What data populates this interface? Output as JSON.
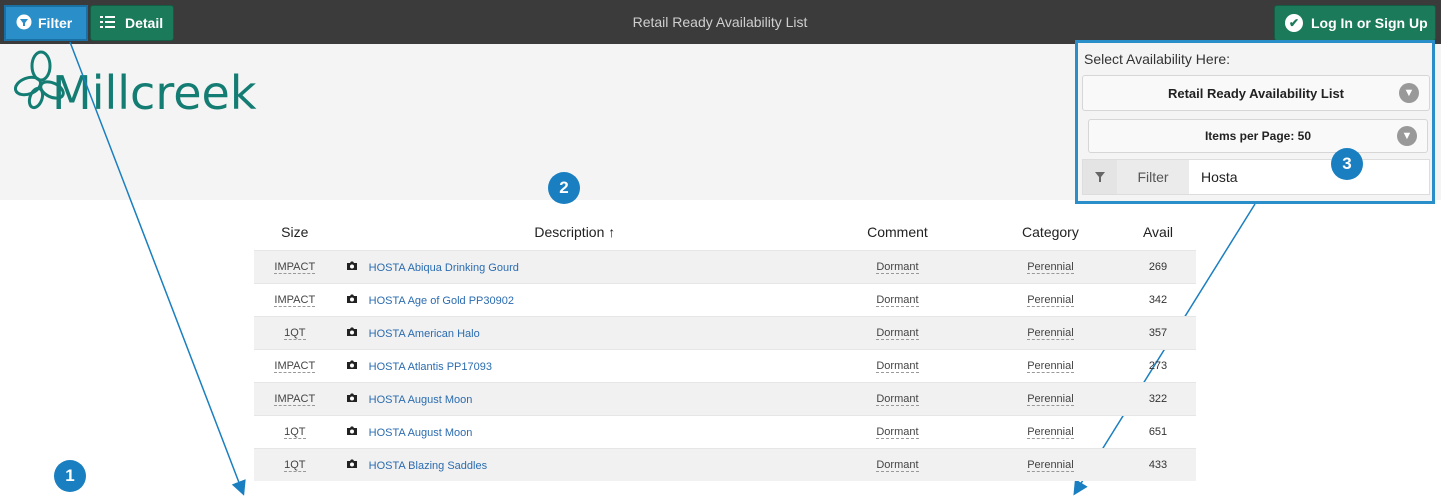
{
  "topbar": {
    "filter_label": "Filter",
    "detail_label": "Detail",
    "title": "Retail Ready Availability List",
    "login_label": "Log In or Sign Up"
  },
  "logo": {
    "text": "Millcreek"
  },
  "panel": {
    "select_label": "Select Availability Here:",
    "availability_value": "Retail Ready Availability List",
    "items_per_page": "Items per Page: 50",
    "filter_label": "Filter",
    "filter_value": "Hosta"
  },
  "badges": [
    "1",
    "2",
    "3"
  ],
  "table": {
    "headers": {
      "size": "Size",
      "description": "Description ↑",
      "comment": "Comment",
      "category": "Category",
      "avail": "Avail"
    },
    "rows": [
      {
        "size": "IMPACT",
        "description": "HOSTA Abiqua Drinking Gourd",
        "comment": "Dormant",
        "category": "Perennial",
        "avail": "269"
      },
      {
        "size": "IMPACT",
        "description": "HOSTA Age of Gold PP30902",
        "comment": "Dormant",
        "category": "Perennial",
        "avail": "342"
      },
      {
        "size": "1QT",
        "description": "HOSTA American Halo",
        "comment": "Dormant",
        "category": "Perennial",
        "avail": "357"
      },
      {
        "size": "IMPACT",
        "description": "HOSTA Atlantis PP17093",
        "comment": "Dormant",
        "category": "Perennial",
        "avail": "273"
      },
      {
        "size": "IMPACT",
        "description": "HOSTA August Moon",
        "comment": "Dormant",
        "category": "Perennial",
        "avail": "322"
      },
      {
        "size": "1QT",
        "description": "HOSTA August Moon",
        "comment": "Dormant",
        "category": "Perennial",
        "avail": "651"
      },
      {
        "size": "1QT",
        "description": "HOSTA Blazing Saddles",
        "comment": "Dormant",
        "category": "Perennial",
        "avail": "433"
      }
    ]
  },
  "colors": {
    "topbar": "#3b3b3b",
    "accent_blue": "#2a8fc8",
    "brand_green": "#1b7a5a",
    "logo_teal": "#147d73"
  }
}
